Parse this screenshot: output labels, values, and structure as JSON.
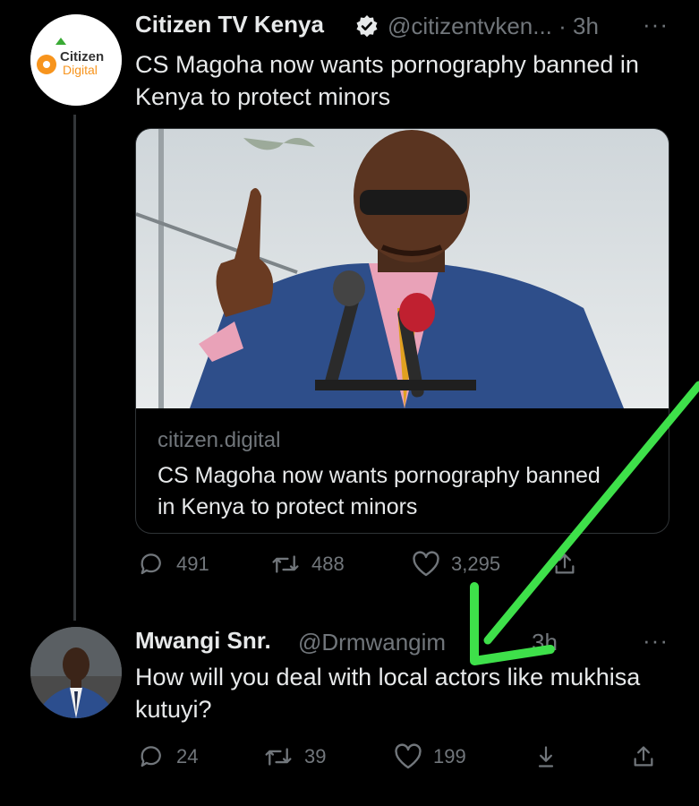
{
  "tweet1": {
    "avatar_logo_line1": "Citizen",
    "avatar_logo_line2": "Digital",
    "display_name": "Citizen TV Kenya",
    "handle_time": "@citizentvken... · 3h",
    "more": "···",
    "text": "CS Magoha now wants pornography banned in Kenya to protect minors",
    "card": {
      "domain": "citizen.digital",
      "title": "CS Magoha now wants pornography banned in Kenya to protect minors"
    },
    "actions": {
      "replies": "491",
      "retweets": "488",
      "likes": "3,295"
    }
  },
  "tweet2": {
    "display_name": "Mwangi Snr.",
    "handle": "@Drmwangim",
    "time": "3h",
    "more": "···",
    "text": "How will you deal with local actors like mukhisa kutuyi?",
    "actions": {
      "replies": "24",
      "retweets": "39",
      "likes": "199"
    }
  },
  "colors": {
    "background": "#000000",
    "text": "#e7e9ea",
    "muted": "#71767b",
    "annotation_arrow": "#3ee04a",
    "brand_orange": "#f7941d",
    "brand_green": "#3aaa35"
  }
}
